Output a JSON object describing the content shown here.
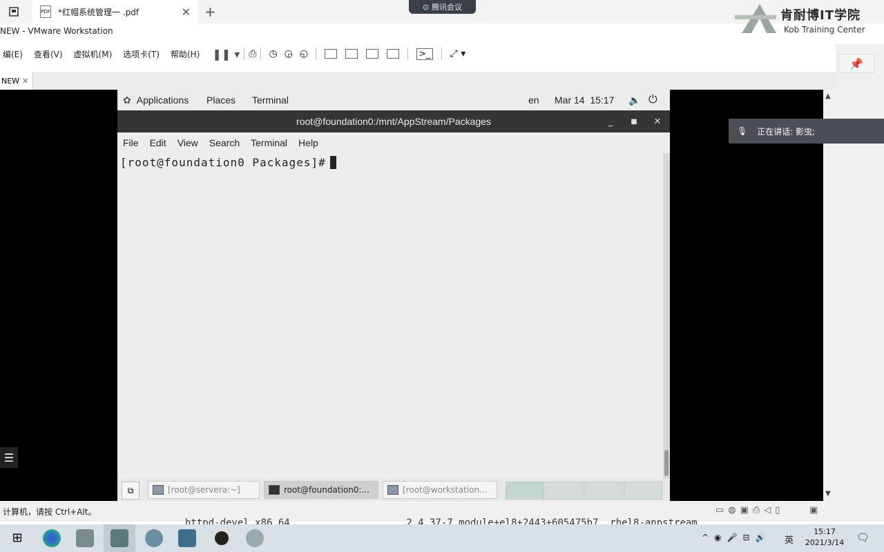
{
  "host": {
    "tab_title": "*红帽系统管理一 .pdf",
    "new_tab_symbol": "+",
    "meeting_badge": "腾讯会议",
    "logo_title": "肯耐博IT学院",
    "logo_subtitle": "Kob Training Center"
  },
  "vmware": {
    "window_title": "NEW - VMware Workstation",
    "menu": [
      "编(E)",
      "查看(V)",
      "虚拟机(M)",
      "选项卡(T)",
      "帮助(H)"
    ],
    "vm_tab": "NEW",
    "status_hint": "计算机，请按 Ctrl+Alt。"
  },
  "gnome": {
    "topbar": {
      "applications": "Applications",
      "places": "Places",
      "terminal": "Terminal",
      "lang": "en",
      "datetime": "Mar 14  15:17"
    },
    "terminal": {
      "title": "root@foundation0:/mnt/AppStream/Packages",
      "menu": [
        "File",
        "Edit",
        "View",
        "Search",
        "Terminal",
        "Help"
      ],
      "prompt": "[root@foundation0 Packages]#"
    },
    "window_list": [
      {
        "label": "[root@servera:~]",
        "active": false
      },
      {
        "label": "root@foundation0:...",
        "active": true
      },
      {
        "label": "[root@workstation...",
        "active": false
      }
    ]
  },
  "meeting": {
    "speaking": "正在讲话: 影虫;"
  },
  "overlay_text": "httpd-devel.x86_64                    2.4.37-7.module+el8+2443+605475b7  rhel8-appstream",
  "taskbar": {
    "time": "15:17",
    "date": "2021/3/14",
    "ime": "英"
  }
}
